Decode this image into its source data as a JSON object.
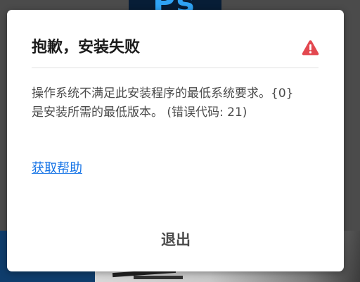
{
  "background": {
    "logo_text": "Ps"
  },
  "dialog": {
    "title": "抱歉，安装失败",
    "message": "操作系统不满足此安装程序的最低系统要求。{0} 是安装所需的最低版本。 (错误代码: 21)",
    "help_link": "获取帮助",
    "quit_button": "退出"
  },
  "icons": {
    "alert": "alert-triangle-icon"
  },
  "colors": {
    "alert_red": "#e34850",
    "link_blue": "#1473e6",
    "title_text": "#1b1b1b",
    "body_text": "#4b4b4b",
    "dialog_bg": "#ffffff",
    "backdrop": "#4b4b4b"
  }
}
